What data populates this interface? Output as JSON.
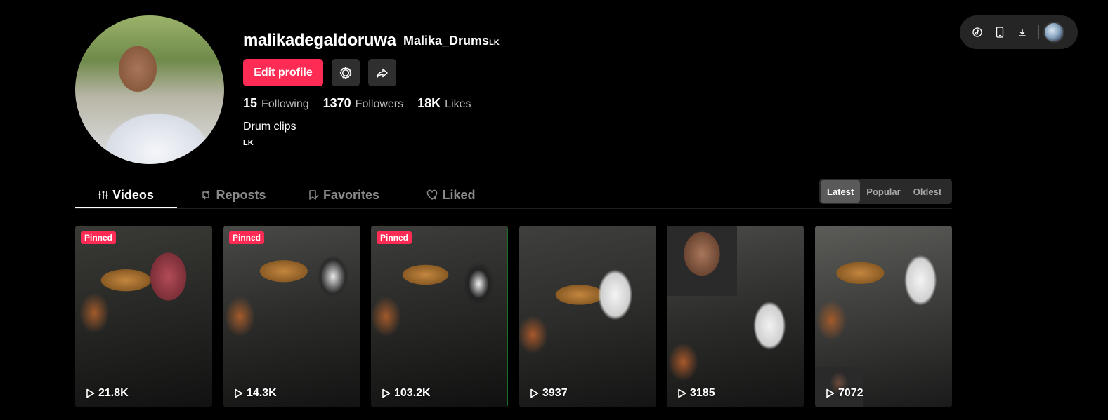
{
  "toolbar": {
    "icons": [
      "tiktok-icon",
      "mobile-icon",
      "download-icon"
    ]
  },
  "profile": {
    "username": "malikadegaldoruwa",
    "nickname": "Malika_Drums",
    "nickname_flag": "LK",
    "edit_label": "Edit profile",
    "stats": [
      {
        "value": "15",
        "label": "Following"
      },
      {
        "value": "1370",
        "label": "Followers"
      },
      {
        "value": "18K",
        "label": "Likes"
      }
    ],
    "bio": "Drum clips",
    "region": "LK"
  },
  "tabs": [
    {
      "label": "Videos",
      "icon": "videos-grid-icon"
    },
    {
      "label": "Reposts",
      "icon": "repost-icon"
    },
    {
      "label": "Favorites",
      "icon": "bookmark-icon"
    },
    {
      "label": "Liked",
      "icon": "heart-icon"
    }
  ],
  "sort": {
    "options": [
      "Latest",
      "Popular",
      "Oldest"
    ],
    "selected": "Latest"
  },
  "videos": [
    {
      "pinned": "Pinned",
      "views": "21.8K"
    },
    {
      "pinned": "Pinned",
      "views": "14.3K"
    },
    {
      "pinned": "Pinned",
      "views": "103.2K"
    },
    {
      "pinned": "",
      "views": "3937"
    },
    {
      "pinned": "",
      "views": "3185"
    },
    {
      "pinned": "",
      "views": "7072"
    }
  ],
  "colors": {
    "accent": "#fe2c55",
    "background": "#000000",
    "secondary_button": "#2f2f2f"
  }
}
